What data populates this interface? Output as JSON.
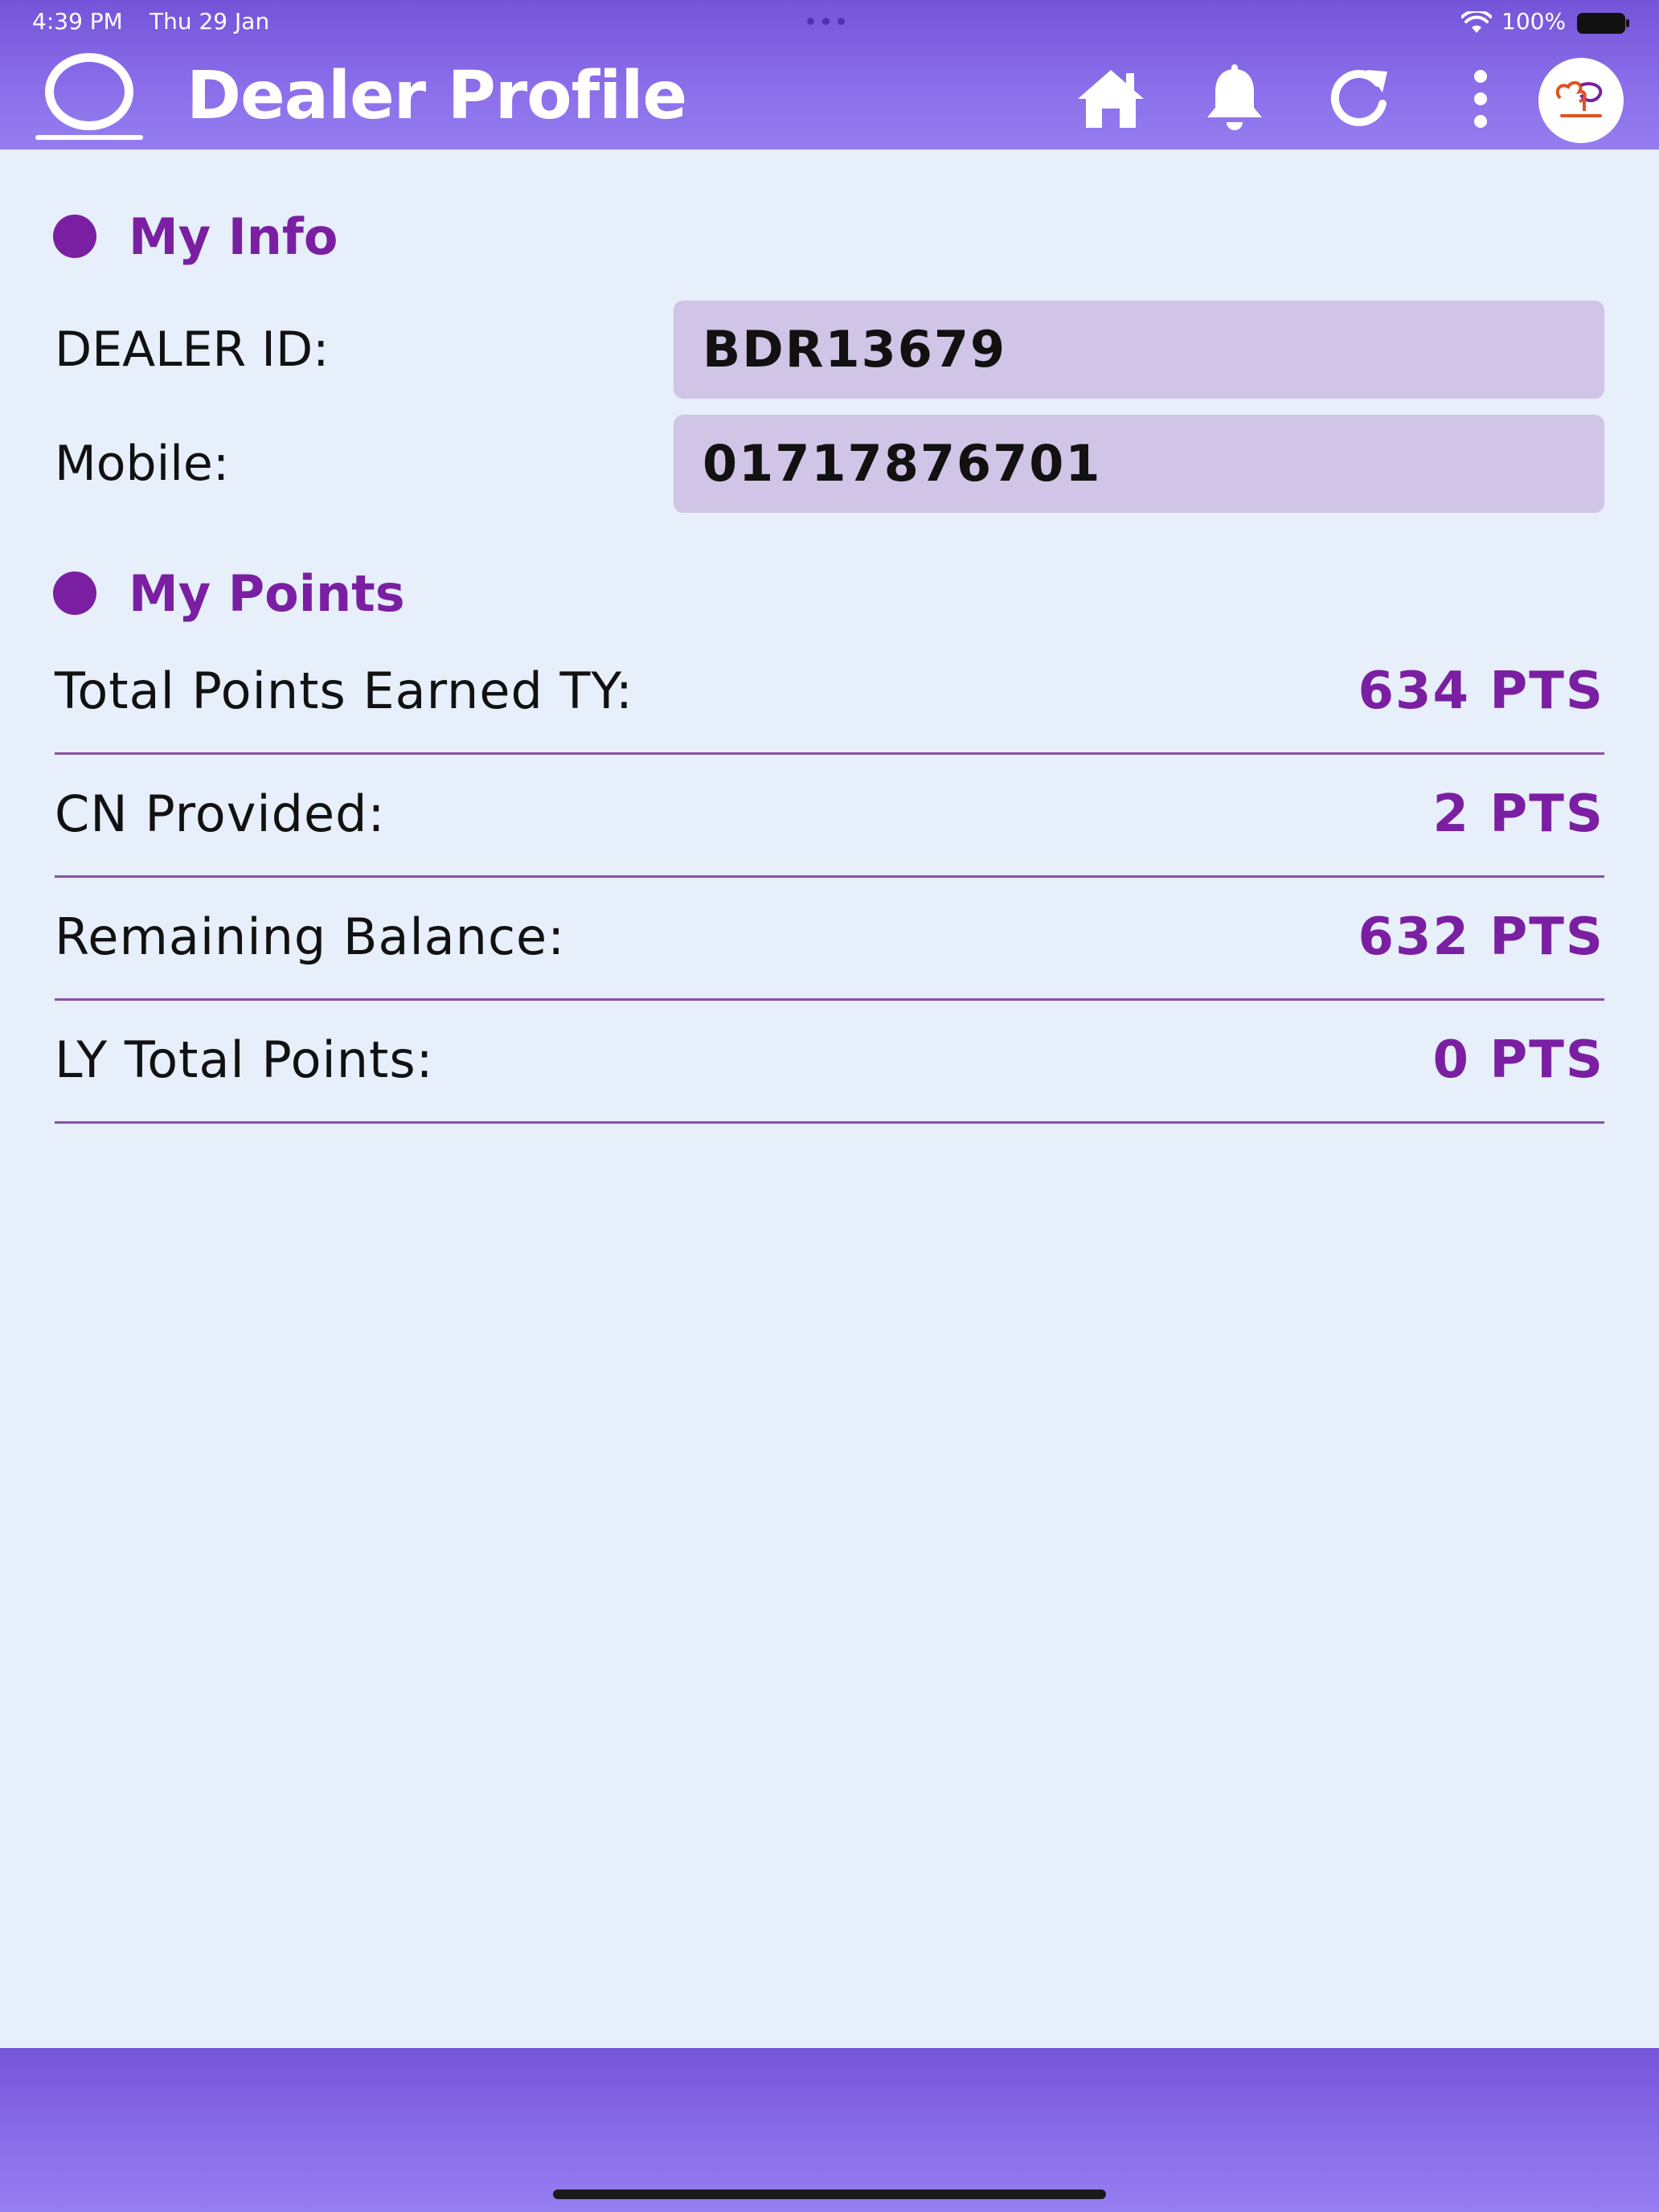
{
  "status_bar": {
    "time": "4:39 PM",
    "date": "Thu 29 Jan",
    "battery": "100%"
  },
  "header": {
    "title": "Dealer Profile",
    "icons": [
      "menu-ring-icon",
      "home-icon",
      "bell-icon",
      "refresh-icon",
      "more-vertical-icon",
      "avatar-logo"
    ]
  },
  "my_info": {
    "title": "My Info",
    "dealer_id_label": "DEALER ID:",
    "dealer_id_value": "BDR13679",
    "mobile_label": "Mobile:",
    "mobile_value": "01717876701"
  },
  "my_points": {
    "title": "My Points",
    "rows": [
      {
        "label": "Total Points Earned TY:",
        "value": "634 PTS"
      },
      {
        "label": "CN Provided:",
        "value": "2 PTS"
      },
      {
        "label": "Remaining Balance:",
        "value": "632 PTS"
      },
      {
        "label": "LY Total Points:",
        "value": "0 PTS"
      }
    ]
  },
  "colors": {
    "header_gradient_top": "#7454d8",
    "header_gradient_bottom": "#957ef0",
    "background": "#e6effa",
    "accent": "#7a1fa2",
    "field_background": "#d0c4e7",
    "divider": "#8a50a8"
  }
}
